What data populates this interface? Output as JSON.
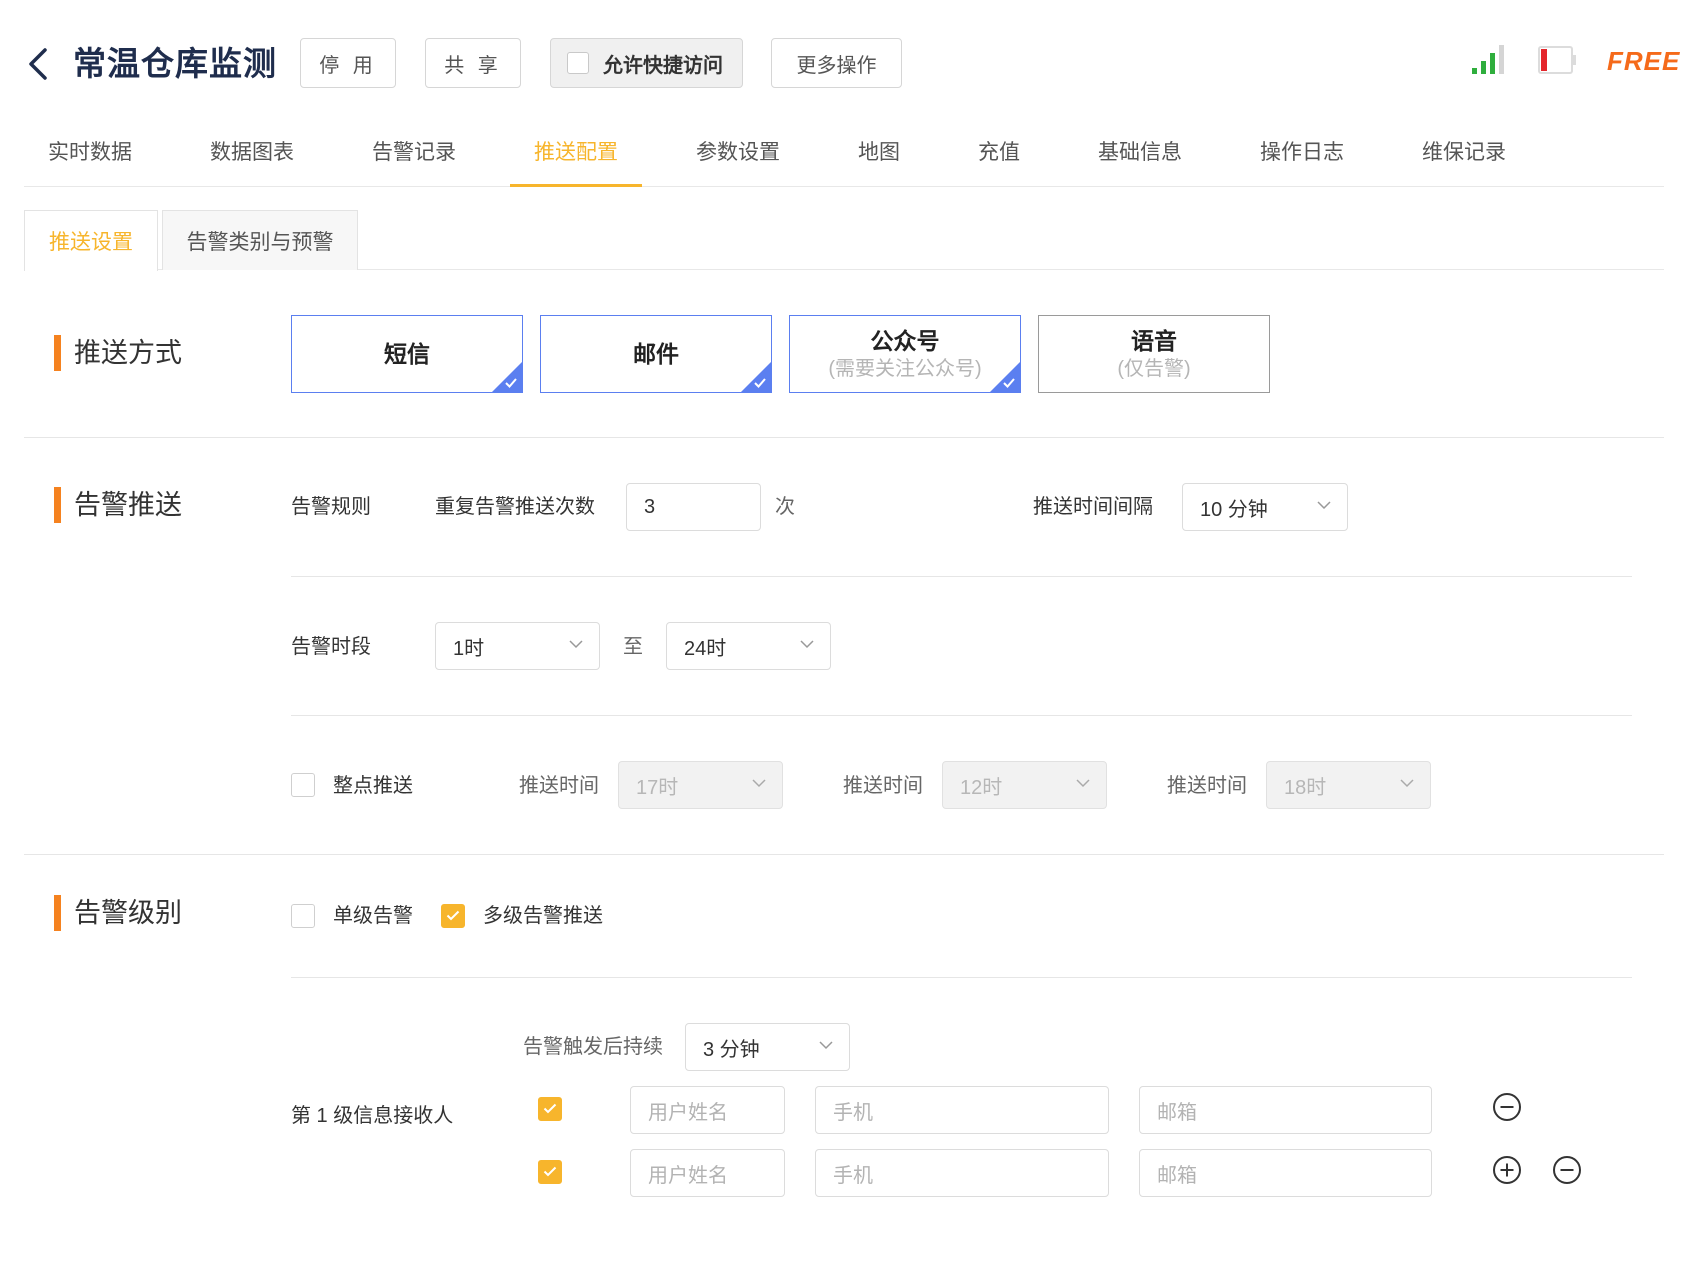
{
  "header": {
    "title": "常温仓库监测",
    "buttons": {
      "disable": "停 用",
      "share": "共 享",
      "quick_access": "允许快捷访问",
      "more": "更多操作"
    },
    "free_label": "FREE",
    "colors": {
      "accent": "#f7b52c",
      "free": "#f56a1a",
      "signal": "#2fae3d",
      "battery": "#e4262b"
    }
  },
  "main_tabs": [
    "实时数据",
    "数据图表",
    "告警记录",
    "推送配置",
    "参数设置",
    "地图",
    "充值",
    "基础信息",
    "操作日志",
    "维保记录"
  ],
  "main_tab_active": "推送配置",
  "sub_tabs": [
    "推送设置",
    "告警类别与预警"
  ],
  "sub_tab_active": "推送设置",
  "push_method": {
    "title": "推送方式",
    "cards": [
      {
        "name": "短信",
        "sub": "",
        "selected": true
      },
      {
        "name": "邮件",
        "sub": "",
        "selected": true
      },
      {
        "name": "公众号",
        "sub": "(需要关注公众号)",
        "selected": true
      },
      {
        "name": "语音",
        "sub": "(仅告警)",
        "selected": false
      }
    ]
  },
  "alarm_push": {
    "title": "告警推送",
    "rule_label": "告警规则",
    "repeat_label": "重复告警推送次数",
    "repeat_value": "3",
    "repeat_unit": "次",
    "interval_label": "推送时间间隔",
    "interval_value": "10 分钟",
    "period_label": "告警时段",
    "period_from": "1时",
    "period_to_label": "至",
    "period_to": "24时",
    "hourly_label": "整点推送",
    "hourly_checked": false,
    "push_time_label": "推送时间",
    "push_times": [
      "17时",
      "12时",
      "18时"
    ]
  },
  "alarm_level": {
    "title": "告警级别",
    "single_label": "单级告警",
    "single_checked": false,
    "multi_label": "多级告警推送",
    "multi_checked": true,
    "trigger_label": "告警触发后持续",
    "trigger_value": "3 分钟",
    "receiver_label": "第 1 级信息接收人",
    "placeholders": {
      "name": "用户姓名",
      "phone": "手机",
      "email": "邮箱"
    },
    "rows": [
      {
        "checked": true,
        "actions": [
          "remove"
        ]
      },
      {
        "checked": true,
        "actions": [
          "add",
          "remove"
        ]
      }
    ]
  }
}
